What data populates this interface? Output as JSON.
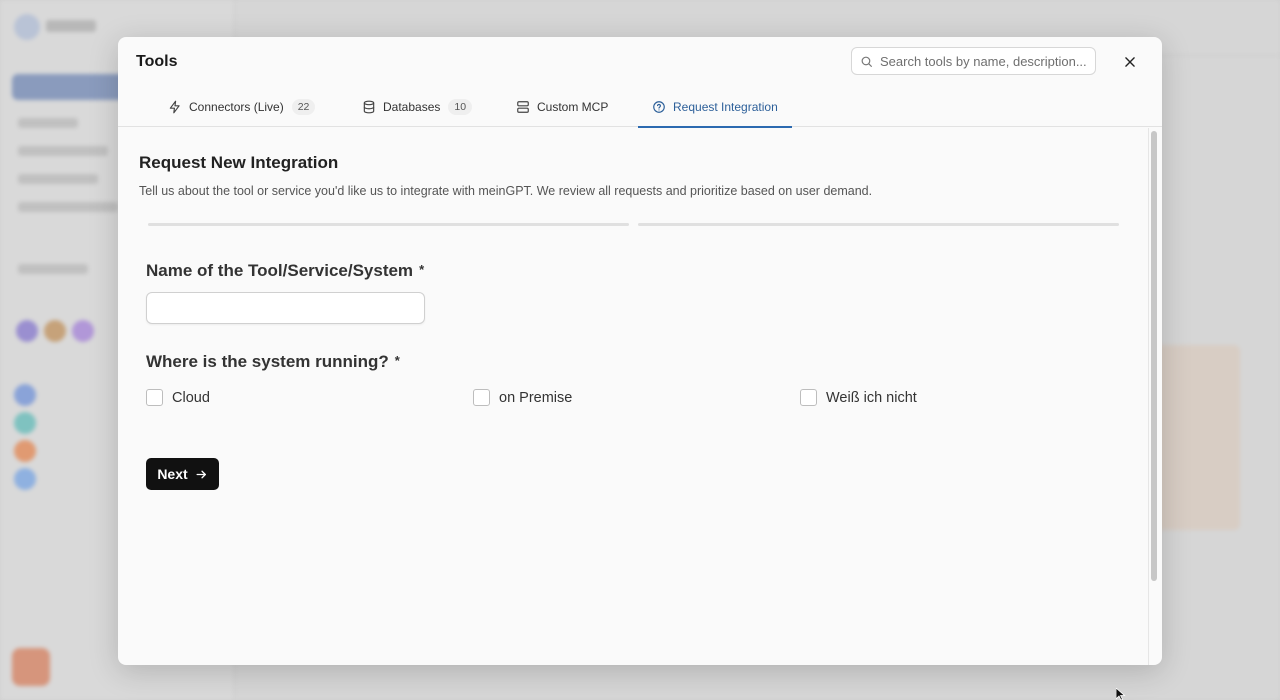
{
  "modal": {
    "title": "Tools",
    "search_placeholder": "Search tools by name, description...",
    "tabs": [
      {
        "label": "Connectors (Live)",
        "count": "22",
        "icon": "lightning-icon"
      },
      {
        "label": "Databases",
        "count": "10",
        "icon": "database-icon"
      },
      {
        "label": "Custom MCP",
        "icon": "server-icon"
      },
      {
        "label": "Request Integration",
        "icon": "help-circle-icon",
        "active": true
      }
    ]
  },
  "request": {
    "title": "Request New Integration",
    "description": "Tell us about the tool or service you'd like us to integrate with meinGPT. We review all requests and prioritize based on user demand.",
    "name_label": "Name of the Tool/Service/System",
    "required_mark": "*",
    "name_value": "",
    "location_label": "Where is the system running?",
    "options": [
      "Cloud",
      "on Premise",
      "Weiß ich nicht"
    ],
    "next_label": "Next"
  },
  "colors": {
    "accent": "#2c6ab0",
    "button": "#111111"
  }
}
